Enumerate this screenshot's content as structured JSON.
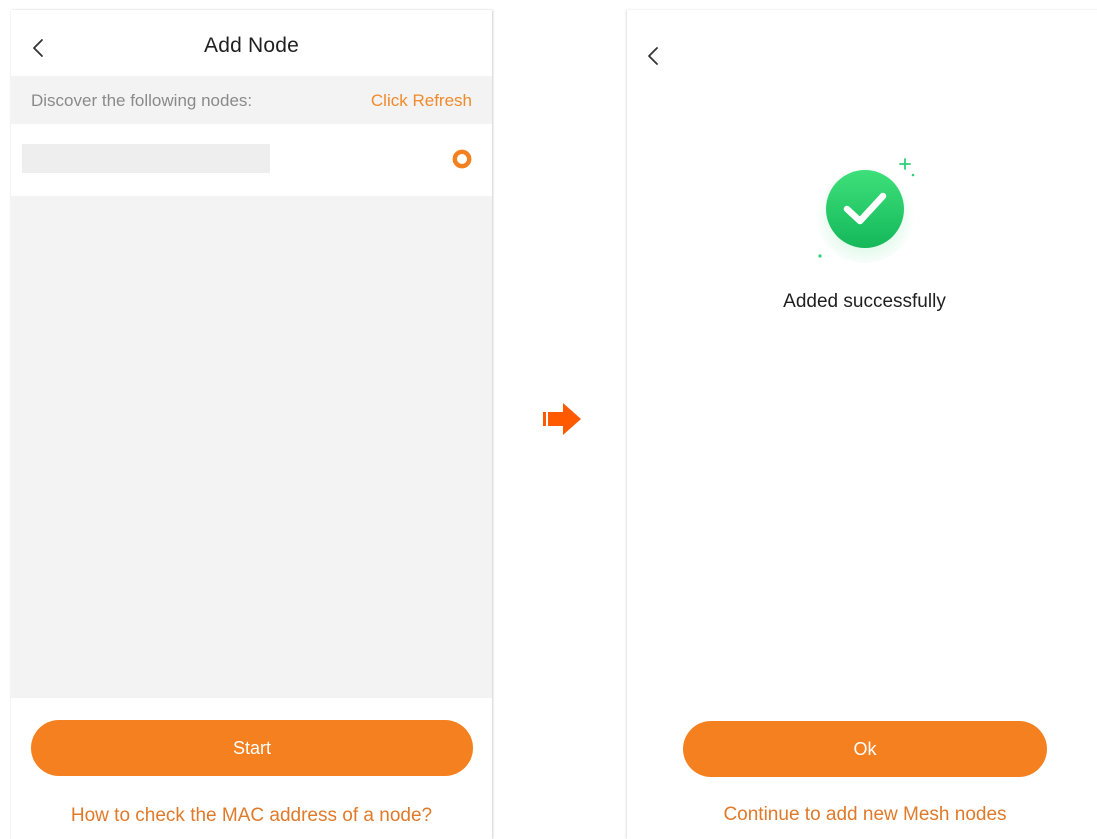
{
  "add_node_screen": {
    "title": "Add Node",
    "back_icon": "chevron-left-icon",
    "discover_label": "Discover the following nodes:",
    "refresh_label": "Click Refresh",
    "node_row": {
      "name": "",
      "radio_icon": "radio-selected-icon"
    },
    "start_button": "Start",
    "help_link": "How to check the MAC address of a node?"
  },
  "transition_icon": "arrow-right-icon",
  "success_screen": {
    "back_icon": "chevron-left-icon",
    "success_icon": "check-circle-icon",
    "message": "Added successfully",
    "ok_button": "Ok",
    "continue_link": "Continue to add new Mesh nodes"
  },
  "colors": {
    "accent_orange": "#f5801f",
    "link_orange": "#e07a2a",
    "success_green": "#22c55e",
    "arrow_orange": "#ff5a00"
  }
}
